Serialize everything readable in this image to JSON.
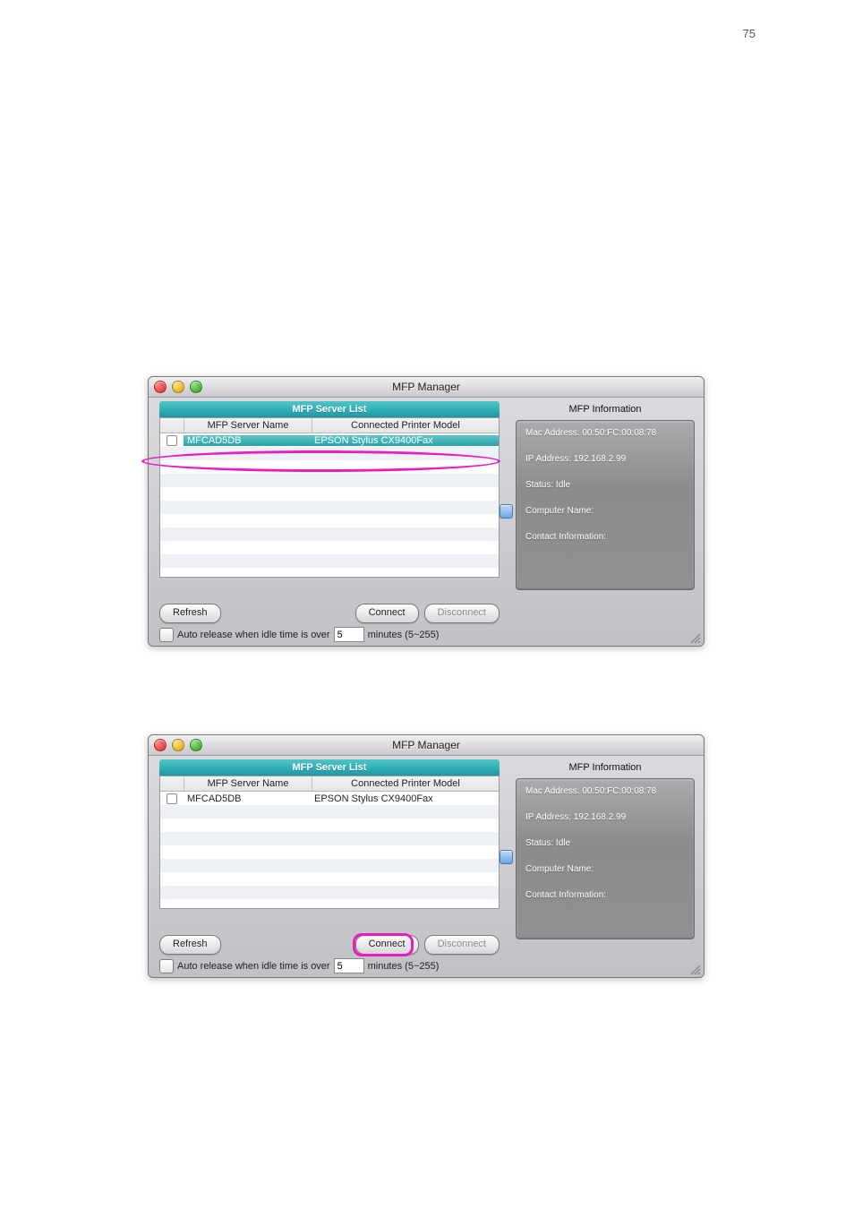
{
  "page_number": "75",
  "window_title": "MFP Manager",
  "server_list_title": "MFP Server List",
  "columns": {
    "name": "MFP Server Name",
    "model": "Connected Printer Model"
  },
  "rows": [
    {
      "checked": false,
      "name": "MFCAD5DB",
      "model": "EPSON Stylus CX9400Fax"
    }
  ],
  "buttons": {
    "refresh": "Refresh",
    "connect": "Connect",
    "disconnect": "Disconnect"
  },
  "auto_release": {
    "label_prefix": "Auto release when idle time is over",
    "value": "5",
    "label_suffix": "minutes (5~255)"
  },
  "info_header": "MFP Information",
  "info": {
    "mac_label": "Mac Address:",
    "mac_value": "00:50:FC:00:08:78",
    "ip_label": "IP Address:",
    "ip_value": "192.168.2.99",
    "status_label": "Status:",
    "status_value": "Idle",
    "computer_label": "Computer Name:",
    "computer_value": "",
    "contact_label": "Contact Information:",
    "contact_value": ""
  },
  "win1": {
    "row_selected": true,
    "row_highlighted": true,
    "disconnect_enabled": false,
    "connect_highlighted": false
  },
  "win2": {
    "row_selected": false,
    "row_highlighted": false,
    "disconnect_enabled": false,
    "connect_highlighted": true
  }
}
